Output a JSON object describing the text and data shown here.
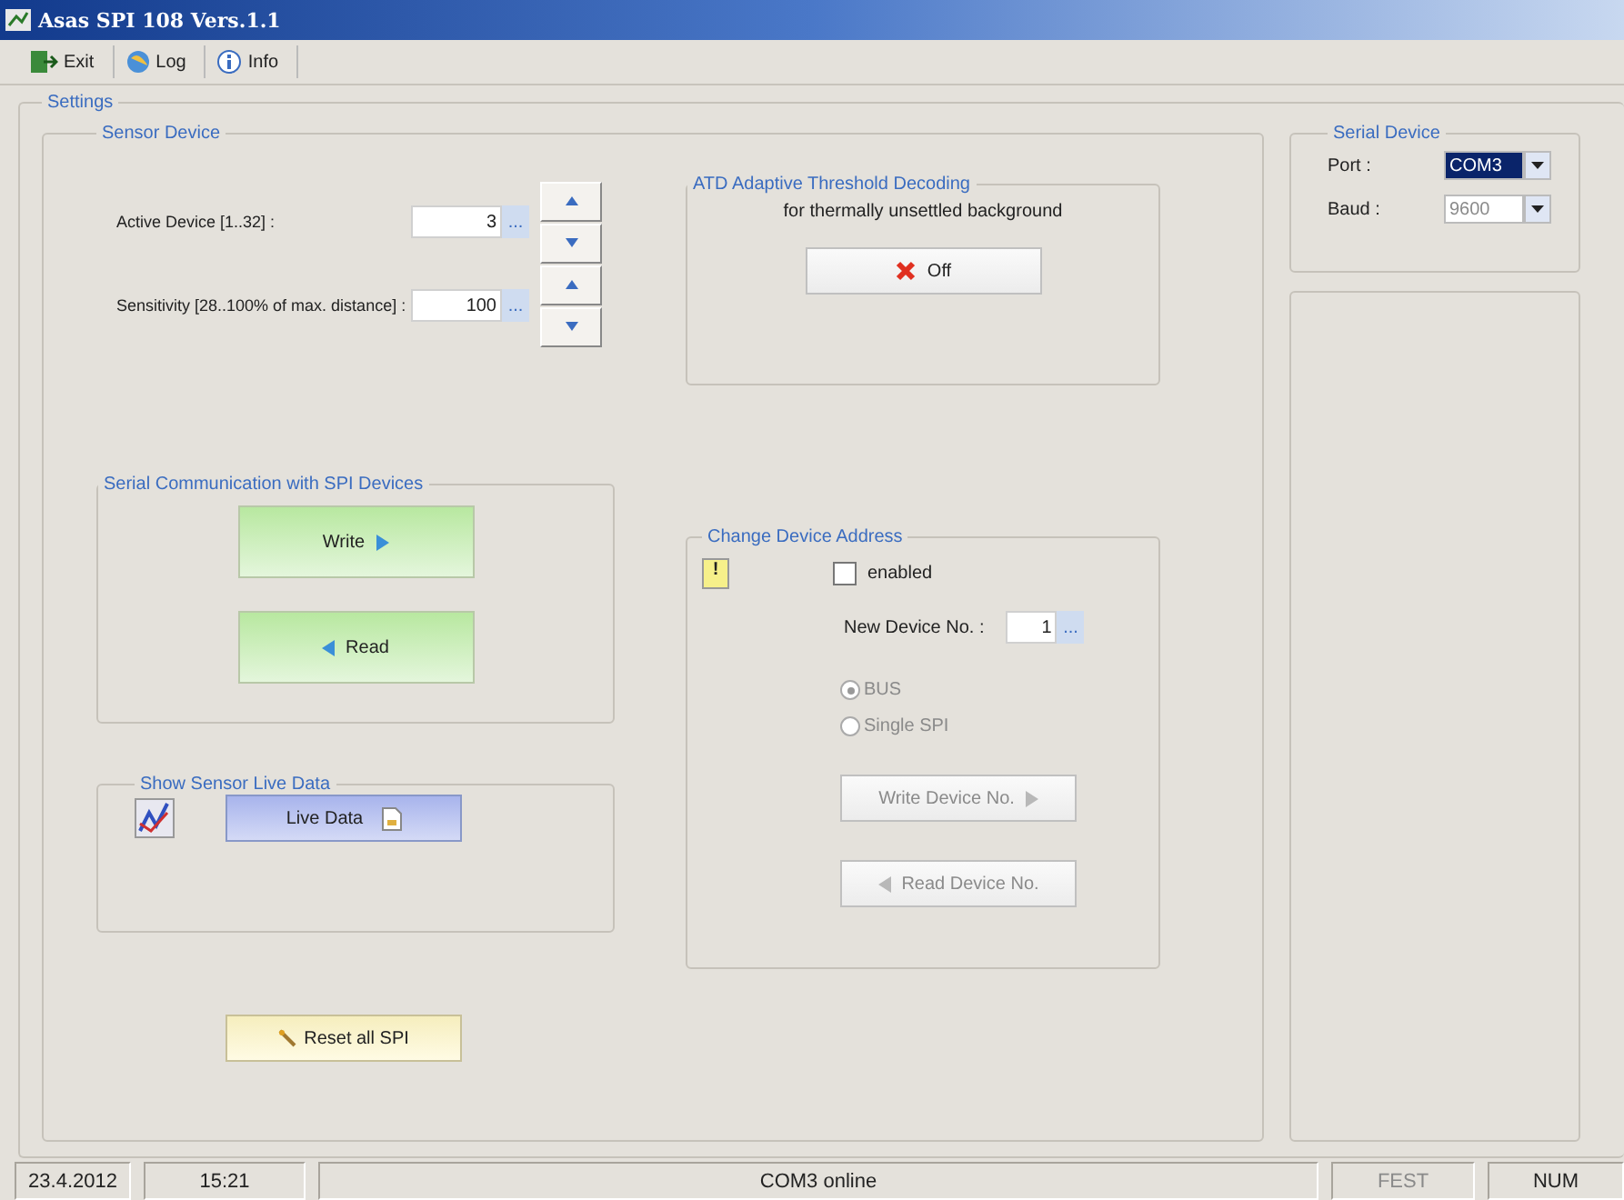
{
  "window": {
    "title": "Asas SPI 108 Vers.1.1"
  },
  "toolbar": [
    {
      "label": "Exit",
      "kind": "exit"
    },
    {
      "label": "Log",
      "kind": "log"
    },
    {
      "label": "Info",
      "kind": "info"
    }
  ],
  "settings": {
    "title": "Settings",
    "sensor_device": {
      "title": "Sensor Device",
      "spinners": [
        {
          "label": "Active Device [1..32] :",
          "value": "3",
          "browse": "..."
        },
        {
          "label": "Sensitivity [28..100% of max. distance] :",
          "value": "100",
          "browse": "..."
        }
      ],
      "atd": {
        "title": "ATD Adaptive Threshold Decoding",
        "description": "for thermally unsettled background",
        "button": "Off"
      },
      "serial_communication": {
        "title": "Serial Communication with SPI Devices",
        "write_button": "Write",
        "read_button": "Read"
      },
      "live_data": {
        "title": "Show Sensor Live Data",
        "button": "Live Data"
      },
      "reset_button": "Reset all SPI",
      "change_address": {
        "title": "Change Device Address",
        "warning_mark": "!",
        "enabled": {
          "label": "enabled",
          "checked": false
        },
        "new_device": {
          "label": "New Device No. :",
          "value": "1",
          "browse": "..."
        },
        "radios": [
          {
            "label": "BUS",
            "selected": true,
            "disabled": true
          },
          {
            "label": "Single SPI",
            "selected": false,
            "disabled": true
          }
        ],
        "buttons": [
          {
            "label": "Write Device No.",
            "kind": "write",
            "disabled": true
          },
          {
            "label": "Read Device No.",
            "kind": "read",
            "disabled": true
          }
        ]
      }
    },
    "serial_device": {
      "title": "Serial Device",
      "combos": [
        {
          "label": "Port :",
          "value": "COM3",
          "highlighted": true,
          "disabled": false
        },
        {
          "label": "Baud :",
          "value": "9600",
          "highlighted": false,
          "disabled": true
        }
      ]
    }
  },
  "status_bar": [
    {
      "text": "23.4.2012",
      "disabled": false
    },
    {
      "text": "15:21",
      "disabled": false
    },
    {
      "text": "COM3 online",
      "disabled": false
    },
    {
      "text": "FEST",
      "disabled": true
    },
    {
      "text": "NUM",
      "disabled": false
    }
  ]
}
